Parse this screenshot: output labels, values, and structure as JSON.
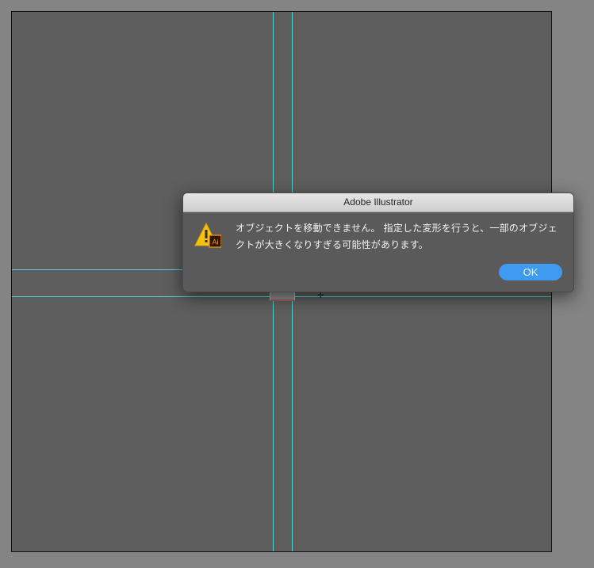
{
  "dialog": {
    "title": "Adobe Illustrator",
    "message": "オブジェクトを移動できません。 指定した変形を行うと、一部のオブジェクトが大きくなりすぎる可能性があります。",
    "ok_label": "OK",
    "icon": "warning-illustrator-icon"
  },
  "colors": {
    "guide": "#4fd4dc",
    "artboard": "#5e5e5e",
    "workspace": "#848484",
    "ok_button": "#3f9af2",
    "warning": "#f5c211",
    "ai_badge": "#ff9a00"
  },
  "icons": {
    "warning": "warning-triangle-icon",
    "app_badge": "illustrator-app-badge"
  },
  "app_badge_text": "Ai"
}
